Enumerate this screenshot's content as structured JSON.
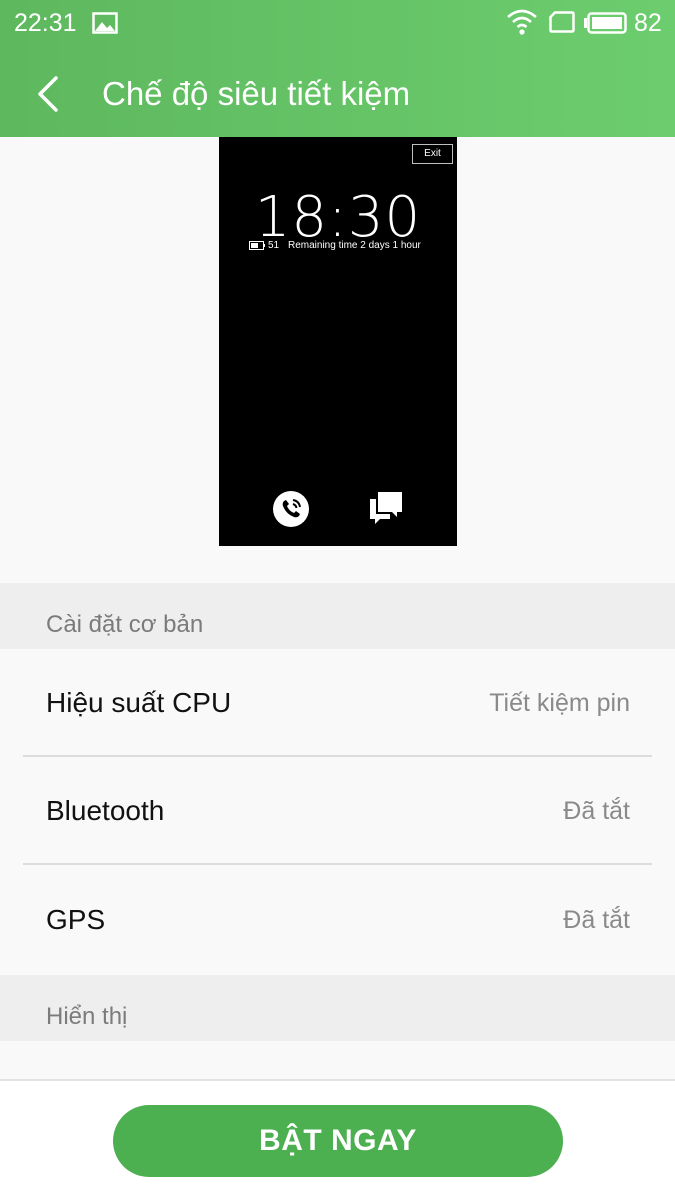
{
  "status_bar": {
    "time": "22:31",
    "battery_level": "82",
    "icons": [
      "image-icon",
      "wifi-icon",
      "sim-icon",
      "battery-icon"
    ]
  },
  "header": {
    "title": "Chế độ siêu tiết kiệm"
  },
  "preview": {
    "exit_label": "Exit",
    "clock": "18:30",
    "battery_level": "51",
    "remaining_text": "Remaining time 2 days 1 hour",
    "icons": [
      "phone-icon",
      "chat-icon"
    ]
  },
  "sections": {
    "basic": {
      "title": "Cài đặt cơ bản",
      "rows": [
        {
          "label": "Hiệu suất CPU",
          "value": "Tiết kiệm pin"
        },
        {
          "label": "Bluetooth",
          "value": "Đã tắt"
        },
        {
          "label": "GPS",
          "value": "Đã tắt"
        }
      ]
    },
    "display": {
      "title": "Hiển thị"
    }
  },
  "cta": {
    "label": "BẬT NGAY"
  },
  "colors": {
    "header_start": "#5eb85e",
    "header_end": "#6ccd6e",
    "button": "#4caf50"
  }
}
